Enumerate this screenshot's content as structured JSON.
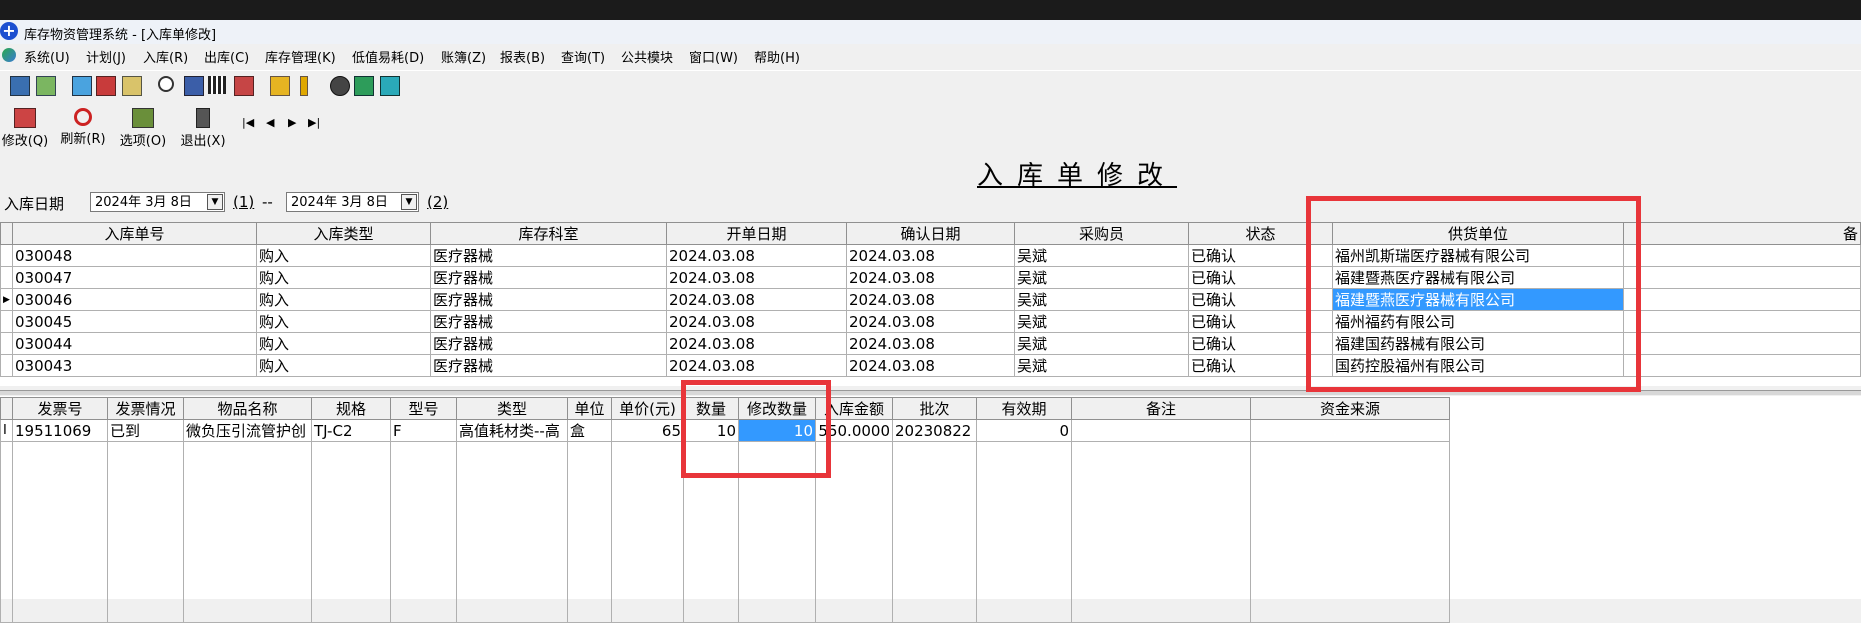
{
  "window": {
    "title": "库存物资管理系统 - [入库单修改]"
  },
  "menu": [
    "系统(U)",
    "计划(J)",
    "入库(R)",
    "出库(C)",
    "库存管理(K)",
    "低值易耗(D)",
    "账簿(Z)",
    "报表(B)",
    "查询(T)",
    "公共模块",
    "窗口(W)",
    "帮助(H)"
  ],
  "actions": {
    "modify": "修改(Q)",
    "refresh": "刷新(R)",
    "options": "选项(O)",
    "exit": "退出(X)"
  },
  "page_title": "入库单修改",
  "filter": {
    "label": "入库日期",
    "from": "2024年 3月 8日",
    "from_tag": "(1)",
    "sep": "--",
    "to": "2024年 3月 8日",
    "to_tag": "(2)"
  },
  "top_grid": {
    "headers": [
      "入库单号",
      "入库类型",
      "库存科室",
      "开单日期",
      "确认日期",
      "采购员",
      "状态",
      "供货单位"
    ],
    "rows": [
      [
        "030048",
        "购入",
        "医疗器械",
        "2024.03.08",
        "2024.03.08",
        "吴斌",
        "已确认",
        "福州凯斯瑞医疗器械有限公司"
      ],
      [
        "030047",
        "购入",
        "医疗器械",
        "2024.03.08",
        "2024.03.08",
        "吴斌",
        "已确认",
        "福建暨燕医疗器械有限公司"
      ],
      [
        "030046",
        "购入",
        "医疗器械",
        "2024.03.08",
        "2024.03.08",
        "吴斌",
        "已确认",
        "福建暨燕医疗器械有限公司"
      ],
      [
        "030045",
        "购入",
        "医疗器械",
        "2024.03.08",
        "2024.03.08",
        "吴斌",
        "已确认",
        "福州福药有限公司"
      ],
      [
        "030044",
        "购入",
        "医疗器械",
        "2024.03.08",
        "2024.03.08",
        "吴斌",
        "已确认",
        "福建国药器械有限公司"
      ],
      [
        "030043",
        "购入",
        "医疗器械",
        "2024.03.08",
        "2024.03.08",
        "吴斌",
        "已确认",
        "国药控股福州有限公司"
      ]
    ],
    "selected_row": 2
  },
  "bottom_grid": {
    "headers": [
      "发票号",
      "发票情况",
      "物品名称",
      "规格",
      "型号",
      "类型",
      "单位",
      "单价(元)",
      "数量",
      "修改数量",
      "入库金额",
      "批次",
      "有效期",
      "备注",
      "资金来源"
    ],
    "rows": [
      [
        "19511069",
        "已到",
        "微负压引流管护创",
        "TJ-C2",
        "F",
        "高值耗材类--高",
        "盒",
        "65",
        "10",
        "10",
        "550.0000",
        "20230822",
        "0",
        "",
        ""
      ]
    ]
  }
}
